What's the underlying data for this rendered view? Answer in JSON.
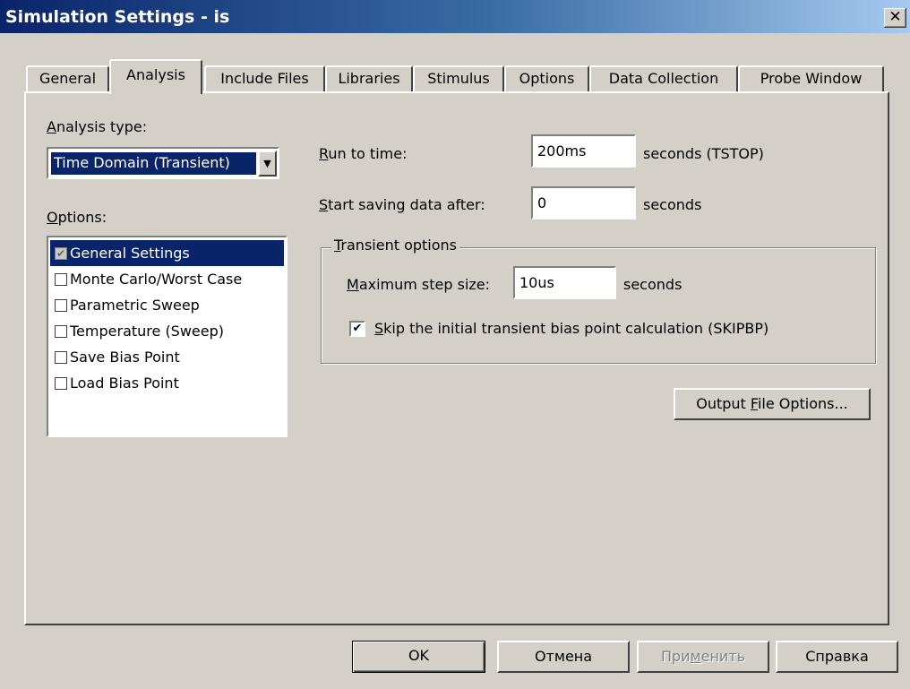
{
  "window": {
    "title": "Simulation Settings - is",
    "close_glyph": "✕"
  },
  "tabs": [
    {
      "label": "General"
    },
    {
      "label": "Analysis"
    },
    {
      "label": "Include Files"
    },
    {
      "label": "Libraries"
    },
    {
      "label": "Stimulus"
    },
    {
      "label": "Options"
    },
    {
      "label": "Data Collection"
    },
    {
      "label": "Probe Window"
    }
  ],
  "active_tab": "Analysis",
  "analysis_type": {
    "label_first": "A",
    "label_rest": "nalysis type:",
    "selected": "Time Domain (Transient)"
  },
  "options": {
    "label_first": "O",
    "label_rest": "ptions:",
    "items": [
      {
        "label": "General Settings",
        "checked": true,
        "selected": true
      },
      {
        "label": "Monte Carlo/Worst Case",
        "checked": false
      },
      {
        "label": "Parametric Sweep",
        "checked": false
      },
      {
        "label": "Temperature (Sweep)",
        "checked": false
      },
      {
        "label": "Save Bias Point",
        "checked": false
      },
      {
        "label": "Load Bias Point",
        "checked": false
      }
    ]
  },
  "run_to_time": {
    "label_first": "R",
    "label_rest": "un to time:",
    "value": "200ms",
    "unit": "seconds  (TSTOP)"
  },
  "start_saving": {
    "label_first": "S",
    "label_rest": "tart saving data after:",
    "value": "0",
    "unit": "seconds"
  },
  "transient_options": {
    "legend_first": "T",
    "legend_rest": "ransient options",
    "max_step": {
      "label_first": "M",
      "label_rest": "aximum step size:",
      "value": "10us",
      "unit": "seconds"
    },
    "skip_bias": {
      "label_first": "S",
      "label_rest": "kip the initial transient bias point calculation  (SKIPBP)",
      "checked": true,
      "check_glyph": "✔"
    }
  },
  "output_file_options": {
    "label_before": "Output ",
    "label_u": "F",
    "label_after": "ile Options..."
  },
  "buttons": {
    "ok": "OK",
    "cancel": "Отмена",
    "apply_before": "При",
    "apply_u": "м",
    "apply_after": "енить",
    "help": "Справка"
  },
  "icons": {
    "dropdown": "▼",
    "checkmark": "✔"
  }
}
